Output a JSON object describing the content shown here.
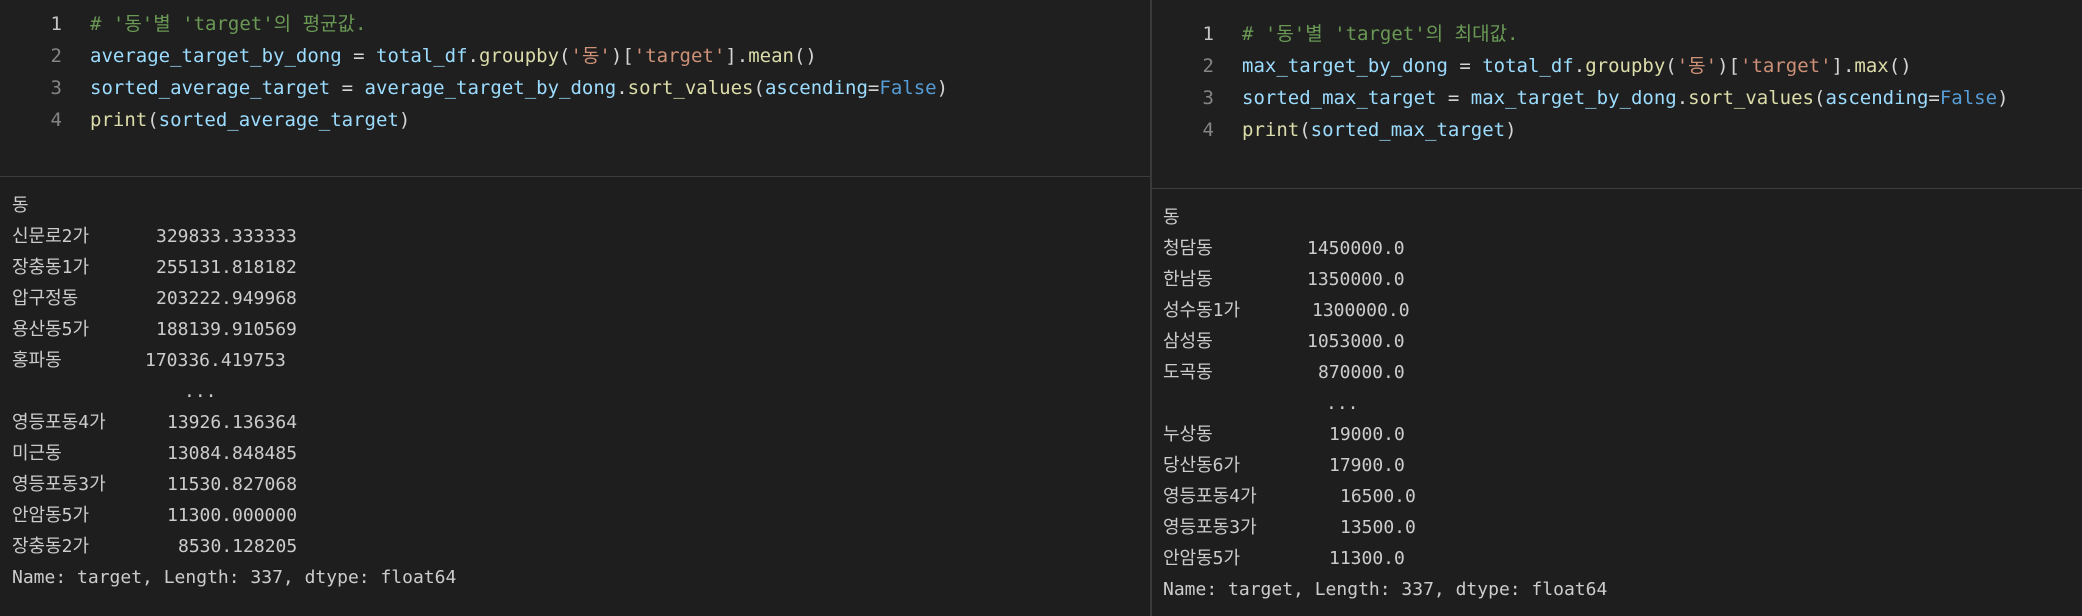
{
  "left": {
    "code": {
      "lines": [
        {
          "num": "1",
          "comment": "# '동'별 'target'의 평균값."
        },
        {
          "num": "2",
          "var": "average_target_by_dong",
          "eq": " = ",
          "obj": "total_df",
          "dot1": ".",
          "method1": "groupby",
          "open1": "(",
          "arg1": "'동'",
          "close1": ")",
          "open2": "[",
          "arg2": "'target'",
          "close2": "]",
          "dot2": ".",
          "method2": "mean",
          "call": "()"
        },
        {
          "num": "3",
          "var": "sorted_average_target",
          "eq": " = ",
          "obj": "average_target_by_dong",
          "dot1": ".",
          "method1": "sort_values",
          "open1": "(",
          "param": "ascending",
          "eq2": "=",
          "kw": "False",
          "close1": ")"
        },
        {
          "num": "4",
          "fn": "print",
          "open": "(",
          "arg": "sorted_average_target",
          "close": ")"
        }
      ]
    },
    "output": {
      "header": "동",
      "rows_top": [
        {
          "label": "신문로2가",
          "value": "329833.333333"
        },
        {
          "label": "장충동1가",
          "value": "255131.818182"
        },
        {
          "label": "압구정동",
          "value": "203222.949968"
        },
        {
          "label": "용산동5가",
          "value": "188139.910569"
        },
        {
          "label": "홍파동",
          "value": "170336.419753"
        }
      ],
      "ellipsis": "...",
      "rows_bottom": [
        {
          "label": "영등포동4가",
          "value": "13926.136364"
        },
        {
          "label": "미근동",
          "value": "13084.848485"
        },
        {
          "label": "영등포동3가",
          "value": "11530.827068"
        },
        {
          "label": "안암동5가",
          "value": "11300.000000"
        },
        {
          "label": "장충동2가",
          "value": "8530.128205"
        }
      ],
      "footer": "Name: target, Length: 337, dtype: float64"
    }
  },
  "right": {
    "code": {
      "lines": [
        {
          "num": "1",
          "comment": "# '동'별 'target'의 최대값."
        },
        {
          "num": "2",
          "var": "max_target_by_dong",
          "eq": " = ",
          "obj": "total_df",
          "dot1": ".",
          "method1": "groupby",
          "open1": "(",
          "arg1": "'동'",
          "close1": ")",
          "open2": "[",
          "arg2": "'target'",
          "close2": "]",
          "dot2": ".",
          "method2": "max",
          "call": "()"
        },
        {
          "num": "3",
          "var": "sorted_max_target",
          "eq": " = ",
          "obj": "max_target_by_dong",
          "dot1": ".",
          "method1": "sort_values",
          "open1": "(",
          "param": "ascending",
          "eq2": "=",
          "kw": "False",
          "close1": ")"
        },
        {
          "num": "4",
          "fn": "print",
          "open": "(",
          "arg": "sorted_max_target",
          "close": ")"
        }
      ]
    },
    "output": {
      "header": "동",
      "rows_top": [
        {
          "label": "청담동",
          "value": "1450000.0"
        },
        {
          "label": "한남동",
          "value": "1350000.0"
        },
        {
          "label": "성수동1가",
          "value": "1300000.0"
        },
        {
          "label": "삼성동",
          "value": "1053000.0"
        },
        {
          "label": "도곡동",
          "value": "870000.0"
        }
      ],
      "ellipsis": "...",
      "rows_bottom": [
        {
          "label": "누상동",
          "value": "19000.0"
        },
        {
          "label": "당산동6가",
          "value": "17900.0"
        },
        {
          "label": "영등포동4가",
          "value": "16500.0"
        },
        {
          "label": "영등포동3가",
          "value": "13500.0"
        },
        {
          "label": "안암동5가",
          "value": "11300.0"
        }
      ],
      "footer": "Name: target, Length: 337, dtype: float64"
    }
  }
}
